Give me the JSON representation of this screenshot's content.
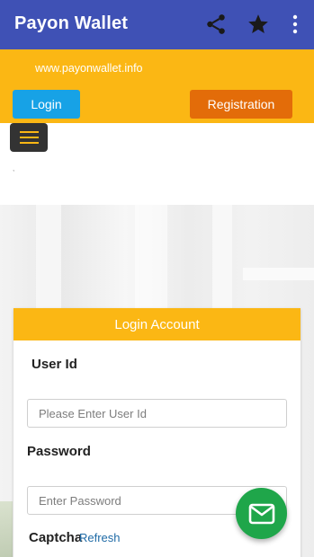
{
  "appbar": {
    "title": "Payon Wallet",
    "icons": [
      "share-icon",
      "star-icon",
      "more-vert-icon"
    ]
  },
  "header": {
    "site_url": "www.payonwallet.info",
    "login_label": "Login",
    "registration_label": "Registration"
  },
  "menu": {
    "icon": "hamburger-menu-icon"
  },
  "login_card": {
    "title": "Login Account",
    "user_id_label": "User Id",
    "user_id_placeholder": "Please Enter User Id",
    "password_label": "Password",
    "password_placeholder": "Enter Password",
    "captcha_label": "Captcha",
    "refresh_label": "Refresh"
  },
  "fab": {
    "icon": "mail-icon"
  },
  "colors": {
    "appbar": "#3f51b5",
    "accent": "#fbb714",
    "login_button": "#17a2e6",
    "registration_button": "#e36c09",
    "fab": "#1fa64a",
    "link": "#1e6aa6"
  }
}
